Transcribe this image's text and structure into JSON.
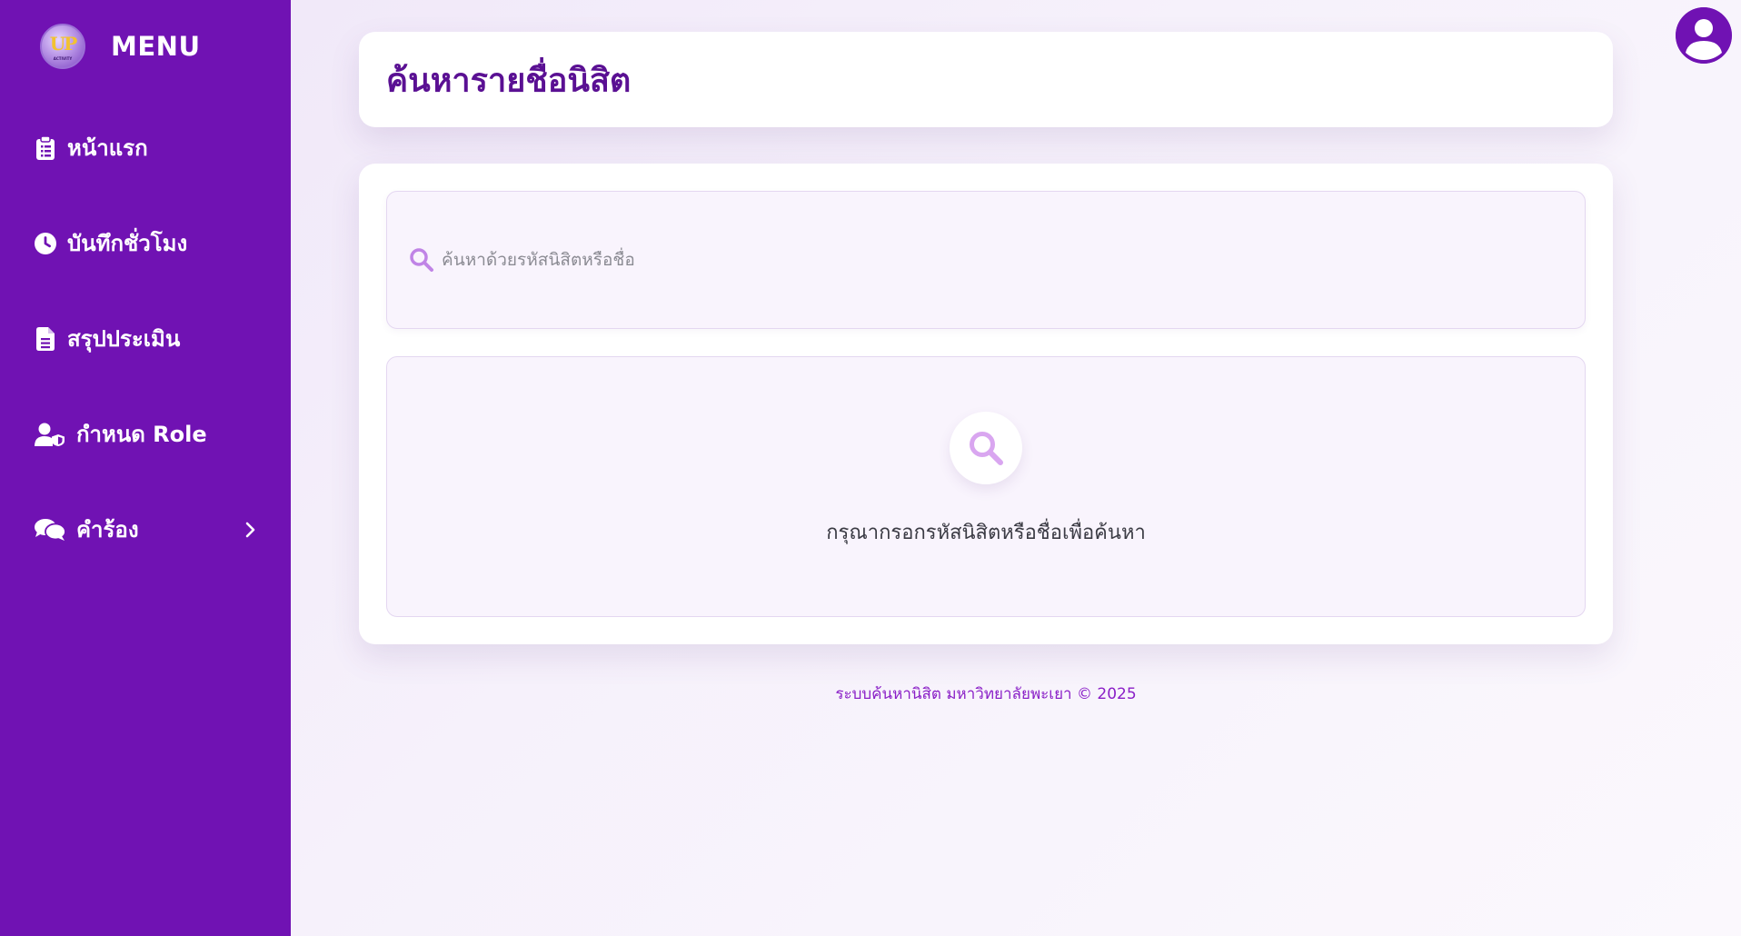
{
  "sidebar": {
    "logo_text": "UP",
    "logo_subtext": "ACTIVITY",
    "title": "MENU",
    "items": [
      {
        "label": "หน้าแรก",
        "icon": "clipboard-icon"
      },
      {
        "label": "บันทึกชั่วโมง",
        "icon": "clock-icon"
      },
      {
        "label": "สรุปประเมิน",
        "icon": "document-icon"
      },
      {
        "label": "กำหนด Role",
        "icon": "user-shield-icon"
      },
      {
        "label": "คำร้อง",
        "icon": "comments-icon",
        "has_submenu": true
      }
    ]
  },
  "header": {
    "title": "ค้นหารายชื่อนิสิต",
    "avatar_icon": "user-circle-icon"
  },
  "search": {
    "placeholder": "ค้นหาด้วยรหัสนิสิตหรือชื่อ",
    "value": ""
  },
  "empty_state": {
    "icon": "search-icon",
    "message": "กรุณากรอกรหัสนิสิตหรือชื่อเพื่อค้นหา"
  },
  "footer": {
    "text": "ระบบค้นหานิสิต มหาวิทยาลัยพะเยา © 2025"
  },
  "colors": {
    "sidebar_bg": "#7012b3",
    "title": "#5a1093",
    "accent_light": "#c084e6",
    "footer_text": "#8a1fc7"
  }
}
